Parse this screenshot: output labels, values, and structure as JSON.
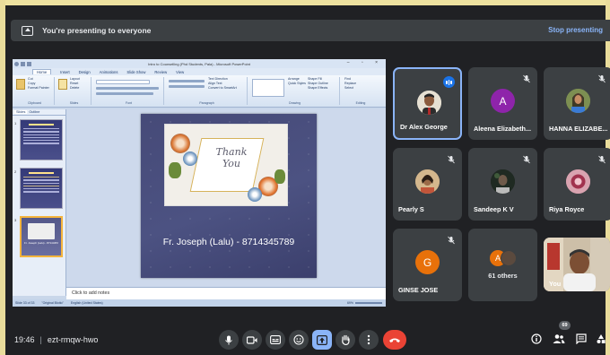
{
  "banner": {
    "message": "You're presenting to everyone",
    "stop_label": "Stop presenting"
  },
  "ppt": {
    "window_title": "Intro to Counselling (Phd Students, Pala) - Microsoft PowerPoint",
    "menus": [
      "Home",
      "Insert",
      "Design",
      "Animations",
      "Slide Show",
      "Review",
      "View"
    ],
    "ribbon": {
      "clipboard": "Clipboard",
      "slides": "Slides",
      "font": "Font",
      "paragraph": "Paragraph",
      "drawing": "Drawing",
      "editing": "Editing",
      "paste": "Paste",
      "cut": "Cut",
      "copy": "Copy",
      "format_painter": "Format Painter",
      "new_slide": "New Slide",
      "layout": "Layout",
      "reset": "Reset",
      "delete": "Delete",
      "text_direction": "Text Direction",
      "align_text": "Align Text",
      "convert_smartart": "Convert to SmartArt",
      "arrange": "Arrange",
      "quick_styles": "Quick Styles",
      "shape_fill": "Shape Fill",
      "shape_outline": "Shape Outline",
      "shape_effects": "Shape Effects",
      "find": "Find",
      "replace": "Replace",
      "select": "Select"
    },
    "side_tabs": [
      "Slides",
      "Outline"
    ],
    "thumbnails": [
      {
        "num": "1"
      },
      {
        "num": "2"
      },
      {
        "num": "3",
        "foot": "Fr. Joseph (Lalu) - 8714345789"
      }
    ],
    "slide": {
      "card_text_line1": "Thank",
      "card_text_line2": "You",
      "footer": "Fr. Joseph (Lalu)  - 8714345789"
    },
    "notes_placeholder": "Click to add notes",
    "status": {
      "slide": "Slide 33 of 33",
      "theme": "\"Original Blotto\"",
      "language": "English (United States)",
      "zoom": "69%"
    }
  },
  "participants": [
    {
      "name": "Dr Alex George",
      "type": "photo",
      "speaking": true
    },
    {
      "name": "Aleena Elizabeth...",
      "type": "initial",
      "initial": "A",
      "color": "#8e24aa",
      "muted": true
    },
    {
      "name": "HANNA ELIZABE...",
      "type": "photo",
      "muted": true
    },
    {
      "name": "Pearly S",
      "type": "photo",
      "muted": true
    },
    {
      "name": "Sandeep K V",
      "type": "photo",
      "muted": true
    },
    {
      "name": "Riya Royce",
      "type": "photo",
      "muted": true
    },
    {
      "name": "GINSE JOSE",
      "type": "initial",
      "initial": "G",
      "color": "#e8710a",
      "muted": true
    },
    {
      "name": "61 others",
      "type": "group",
      "initial": "A"
    },
    {
      "name": "You",
      "type": "video"
    }
  ],
  "bottom": {
    "time": "19:46",
    "meeting_code": "ezt-rmqw-hwo",
    "participant_count": "69"
  },
  "colors": {
    "accent": "#8ab4f8",
    "end_call": "#ea4335",
    "tile_bg": "#3c4043",
    "background": "#202124"
  }
}
